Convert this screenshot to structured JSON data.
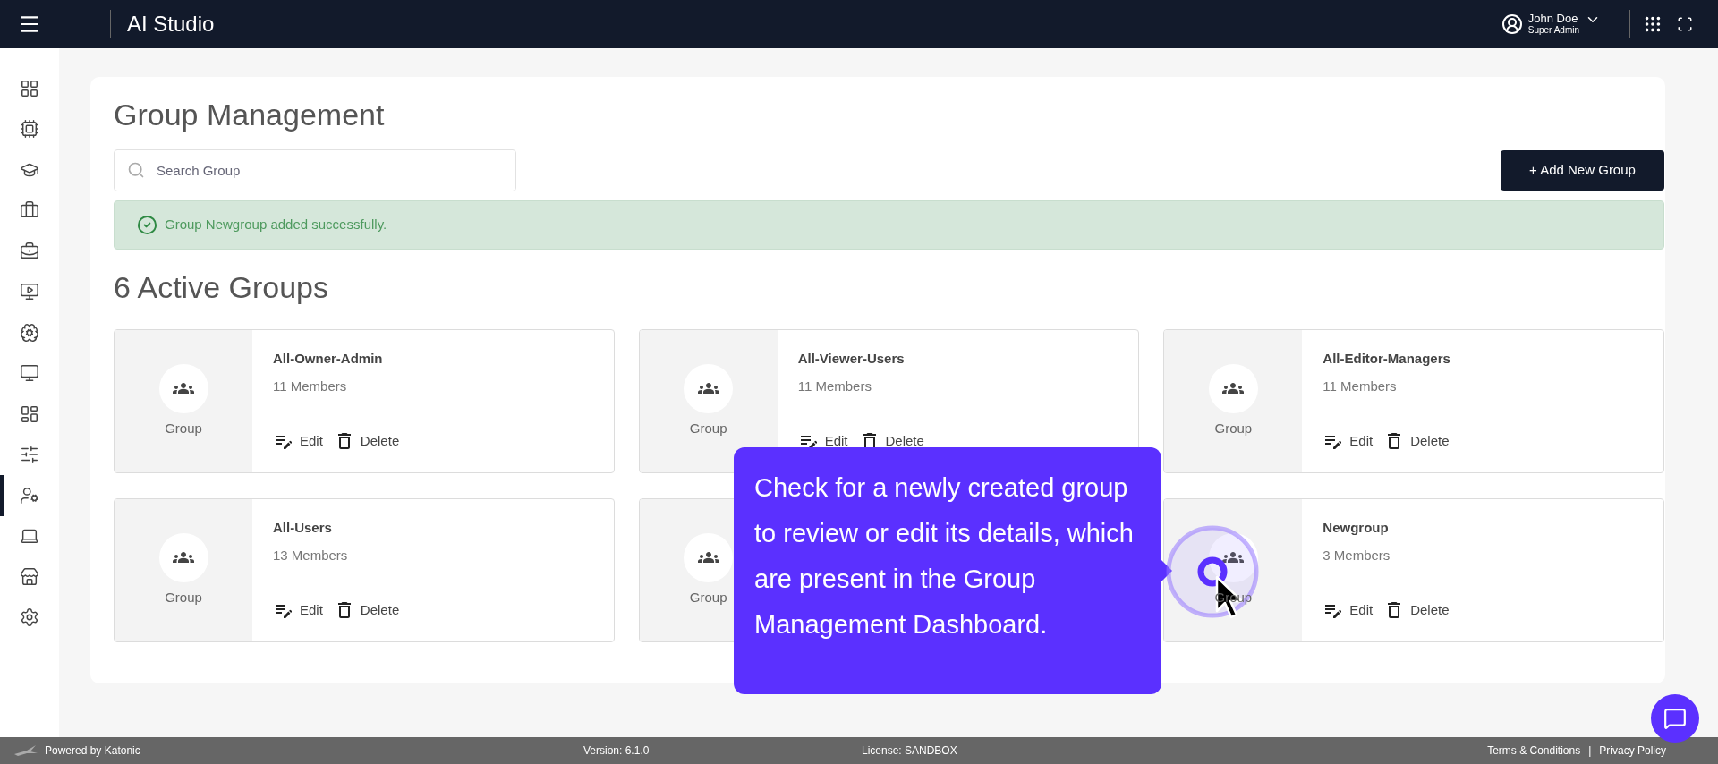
{
  "top_bar": {
    "title": "AI Studio",
    "user": {
      "name": "John Doe",
      "role": "Super Admin"
    }
  },
  "sidebar": {
    "items": [
      {
        "selected": false
      },
      {
        "selected": false
      },
      {
        "selected": false
      },
      {
        "selected": false
      },
      {
        "selected": false
      },
      {
        "selected": false
      },
      {
        "selected": false
      },
      {
        "selected": false
      },
      {
        "selected": false
      },
      {
        "selected": false
      },
      {
        "selected": true
      },
      {
        "selected": false
      },
      {
        "selected": false
      },
      {
        "selected": false
      }
    ]
  },
  "page": {
    "title": "Group Management",
    "search": {
      "placeholder": "Search Group"
    },
    "add_button": "+ Add New Group",
    "alert": "Group Newgroup added successfully.",
    "groups_heading": "6 Active Groups"
  },
  "groups": [
    {
      "image_label": "Group",
      "name": "All-Owner-Admin",
      "members": "11 Members",
      "edit": "Edit",
      "delete": "Delete"
    },
    {
      "image_label": "Group",
      "name": "All-Viewer-Users",
      "members": "11 Members",
      "edit": "Edit",
      "delete": "Delete"
    },
    {
      "image_label": "Group",
      "name": "All-Editor-Managers",
      "members": "11 Members",
      "edit": "Edit",
      "delete": "Delete"
    },
    {
      "image_label": "Group",
      "name": "All-Users",
      "members": "13 Members",
      "edit": "Edit",
      "delete": "Delete"
    },
    {
      "image_label": "Group"
    },
    {
      "image_label": "Group",
      "name": "Newgroup",
      "members": "3 Members",
      "edit": "Edit",
      "delete": "Delete"
    }
  ],
  "tooltip": {
    "text": "Check for a newly created group to review or edit its details, which are present in the Group Management Dashboard."
  },
  "footer": {
    "powered_by": "Powered by Katonic",
    "version": "Version: 6.1.0",
    "license": "License: SANDBOX",
    "terms": "Terms & Conditions",
    "separator": "|",
    "privacy": "Privacy Policy"
  }
}
